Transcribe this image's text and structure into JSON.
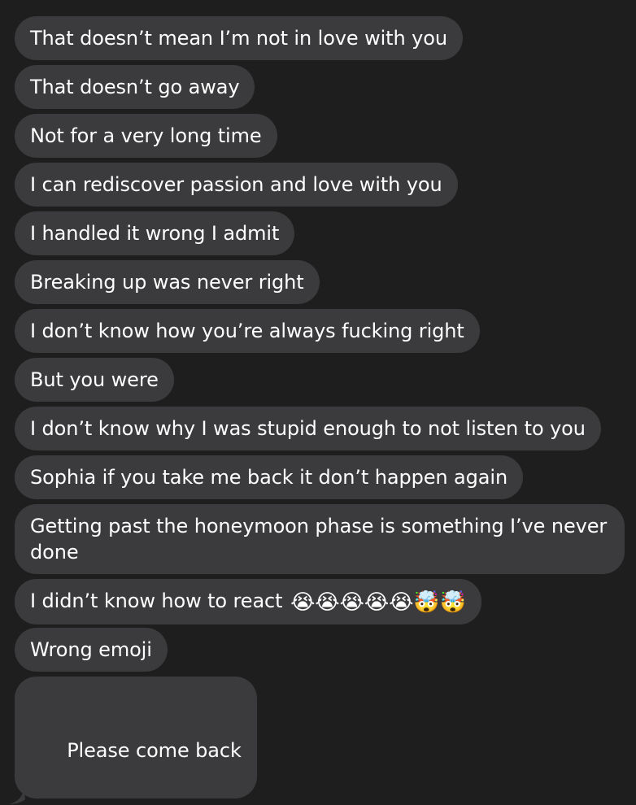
{
  "messages": [
    {
      "text": "That doesn’t mean I’m not in love with you"
    },
    {
      "text": "That doesn’t go away"
    },
    {
      "text": "Not for a very long time"
    },
    {
      "text": "I can rediscover passion and love with you"
    },
    {
      "text": "I handled it wrong I admit"
    },
    {
      "text": "Breaking up was never right"
    },
    {
      "text": "I don’t know how you’re always fucking right"
    },
    {
      "text": "But you were"
    },
    {
      "text": "I don’t know why I was stupid enough to not listen to you"
    },
    {
      "text": "Sophia if you take me back it don’t happen again"
    },
    {
      "text": "Getting past the honeymoon phase is something I’ve never done"
    },
    {
      "text": "I didn’t know how to react",
      "emoji": "😭😭😭😭😭🤯🤯"
    },
    {
      "text": "Wrong emoji"
    },
    {
      "text": "Please come back"
    }
  ],
  "colors": {
    "background": "#1e1e1e",
    "bubble": "#3b3b3d",
    "text": "#ffffff"
  }
}
